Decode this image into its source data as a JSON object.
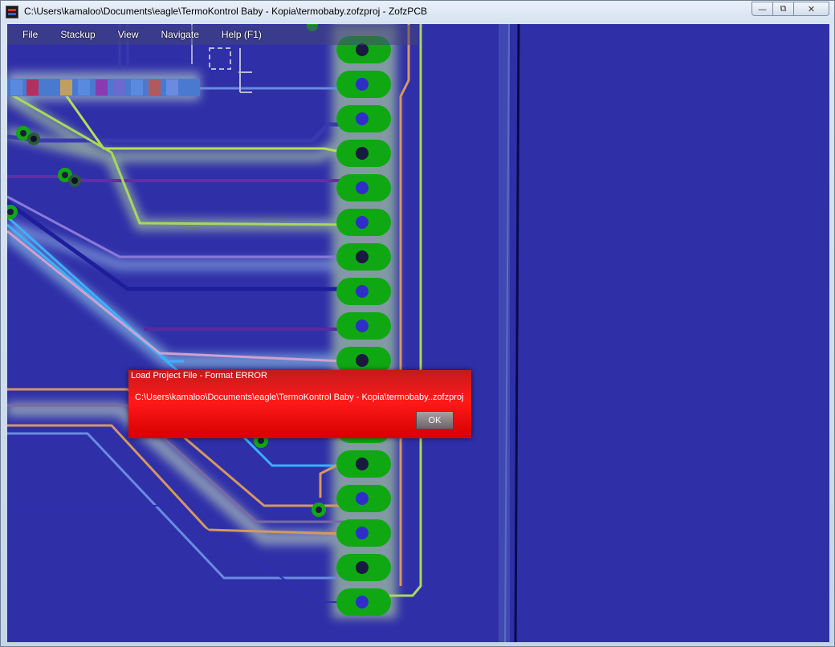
{
  "window": {
    "title": "C:\\Users\\kamaloo\\Documents\\eagle\\TermoKontrol Baby - Kopia\\termobaby.zofzproj - ZofzPCB",
    "buttons": {
      "minimize": "—",
      "maximize": "⧉",
      "close": "✕"
    }
  },
  "menubar": {
    "items": [
      {
        "label": "File"
      },
      {
        "label": "Stackup"
      },
      {
        "label": "View"
      },
      {
        "label": "Navigate"
      },
      {
        "label": "Help (F1)"
      }
    ]
  },
  "dialog": {
    "title": "Load Project File - Format ERROR",
    "message": "C:\\Users\\kamaloo\\Documents\\eagle\\TermoKontrol Baby - Kopia\\termobaby..zofzproj",
    "ok_label": "OK"
  },
  "colors": {
    "board_background": "#2f2fa8",
    "pad_green": "#0fa812",
    "dialog_red": "#ff1a1a"
  },
  "icons": {
    "app": "zofzpcb-app-icon"
  }
}
